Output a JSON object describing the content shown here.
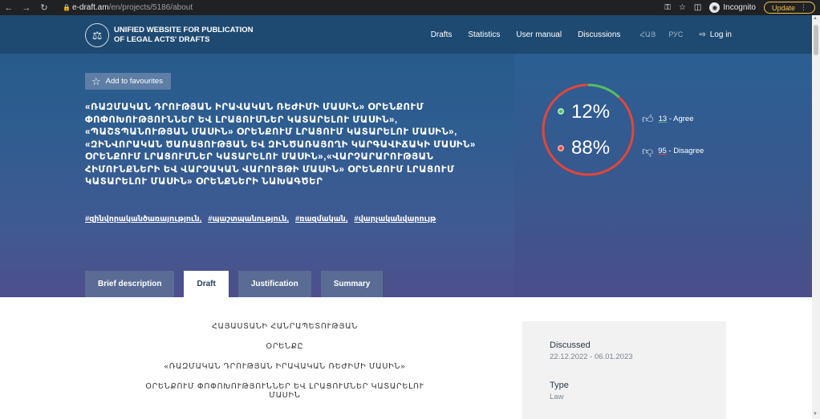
{
  "browser": {
    "url_host": "e-draft.am",
    "url_path": "/en/projects/5186/about",
    "incognito_label": "Incognito",
    "update_label": "Update"
  },
  "header": {
    "site_title_line1": "UNIFIED WEBSITE FOR PUBLICATION",
    "site_title_line2": "OF LEGAL ACTS' DRAFTS",
    "nav": [
      "Drafts",
      "Statistics",
      "User manual",
      "Discussions"
    ],
    "lang_hy": "ՀԱՅ",
    "lang_ru": "РУС",
    "login_label": "Log in"
  },
  "hero": {
    "favourite_label": "Add to favourites",
    "title": "«ՌԱԶՄԱԿԱՆ ԴՐՈՒԹՅԱՆ ԻՐԱՎԱԿԱՆ ՌԵԺԻՄԻ ՄԱՍԻՆ» ՕՐԵՆՔՈՒՄ ՓՈՓՈԽՈՒԹՅՈՒՆՆԵՐ ԵՎ ԼՐԱՑՈՒՄՆԵՐ ԿԱՏԱՐԵԼՈՒ ՄԱՍԻՆ», «ՊԱՇՏՊԱՆՈՒԹՅԱՆ ՄԱՍԻՆ» ՕՐԵՆՔՈՒՄ ԼՐԱՑՈՒՄ ԿԱՏԱՐԵԼՈՒ ՄԱՍԻՆ», «ԶԻՆՎՈՐԱԿԱՆ ԾԱՌԱՅՈՒԹՅԱՆ ԵՎ ԶԻՆԾԱՌԱՅՈՂԻ ԿԱՐԳԱՎԻՃԱԿԻ ՄԱՍԻՆ» ՕՐԵՆՔՈՒՄ ԼՐԱՑՈՒՄՆԵՐ ԿԱՏԱՐԵԼՈՒ ՄԱՍԻՆ»,«ՎԱՐՉԱՐԱՐՈՒԹՅԱՆ ՀԻՄՈՒՆՔՆԵՐԻ ԵՎ ՎԱՐՉԱԿԱՆ ՎԱՐՈՒՅԹԻ ՄԱՍԻՆ» ՕՐԵՆՔՈՒՄ ԼՐԱՑՈՒՄ ԿԱՏԱՐԵԼՈՒ ՄԱՍԻՆ» ՕՐԵՆՔՆԵՐԻ ՆԱԽԱԳԾԵՐ",
    "tags": [
      "#զինվորականծառայություն,",
      "#պաշտպանություն,",
      "#ռազմական,",
      "#վարչականվարույթ"
    ]
  },
  "tabs": [
    {
      "label": "Brief description",
      "active": false
    },
    {
      "label": "Draft",
      "active": true
    },
    {
      "label": "Justification",
      "active": false
    },
    {
      "label": "Summary",
      "active": false
    }
  ],
  "votes": {
    "agree_percent": 12,
    "disagree_percent": 88,
    "agree_pct_text": "12%",
    "disagree_pct_text": "88%",
    "agree_count": "13",
    "agree_label": " - Agree",
    "disagree_count": "95",
    "disagree_label": " - Disagree",
    "agree_color": "#4cbf6a",
    "disagree_color": "#e2463a"
  },
  "draft_lines": [
    "ՀԱՅԱՍՏԱՆԻ ՀԱՆՐԱՊԵՏՈՒԹՅԱՆ",
    "ՕՐԵՆՔԸ",
    "«ՌԱԶՄԱԿԱՆ ԴՐՈՒԹՅԱՆ ԻՐԱՎԱԿԱՆ ՌԵԺԻՄԻ ՄԱՍԻՆ»",
    "ՕՐԵՆՔՈՒՄ ՓՈՓՈԽՈՒԹՅՈՒՆՆԵՐ ԵՎ ԼՐԱՑՈՒՄՆԵՐ ԿԱՏԱՐԵԼՈՒ ՄԱՍԻՆ"
  ],
  "info": {
    "discussed_label": "Discussed",
    "discussed_value": "22.12.2022 - 06.01.2023",
    "type_label": "Type",
    "type_value": "Law"
  }
}
